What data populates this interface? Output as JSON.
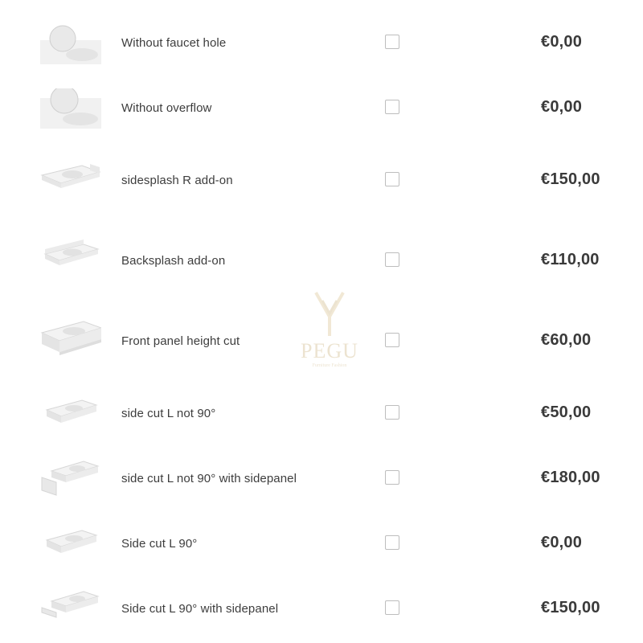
{
  "options": [
    {
      "label": "Without faucet hole",
      "price": "€0,00",
      "image": "sink-round-mirror-thumbnail"
    },
    {
      "label": "Without overflow",
      "price": "€0,00",
      "image": "sink-round-mirror-thumbnail"
    },
    {
      "label": "sidesplash R add-on",
      "price": "€150,00",
      "image": "sink-sidesplash-thumbnail"
    },
    {
      "label": "Backsplash add-on",
      "price": "€110,00",
      "image": "sink-backsplash-thumbnail"
    },
    {
      "label": "Front panel height cut",
      "price": "€60,00",
      "image": "sink-front-panel-thumbnail"
    },
    {
      "label": "side cut L not 90°",
      "price": "€50,00",
      "image": "sink-side-cut-thumbnail"
    },
    {
      "label": "side cut L not 90° with sidepanel",
      "price": "€180,00",
      "image": "sink-side-cut-panel-thumbnail"
    },
    {
      "label": "Side cut L 90°",
      "price": "€0,00",
      "image": "sink-side-cut-thumbnail"
    },
    {
      "label": "Side cut L 90° with sidepanel",
      "price": "€150,00",
      "image": "sink-side-cut-panel-thumbnail"
    }
  ],
  "watermark": {
    "brand": "PEGU",
    "tagline": "Furniture Fashion"
  }
}
